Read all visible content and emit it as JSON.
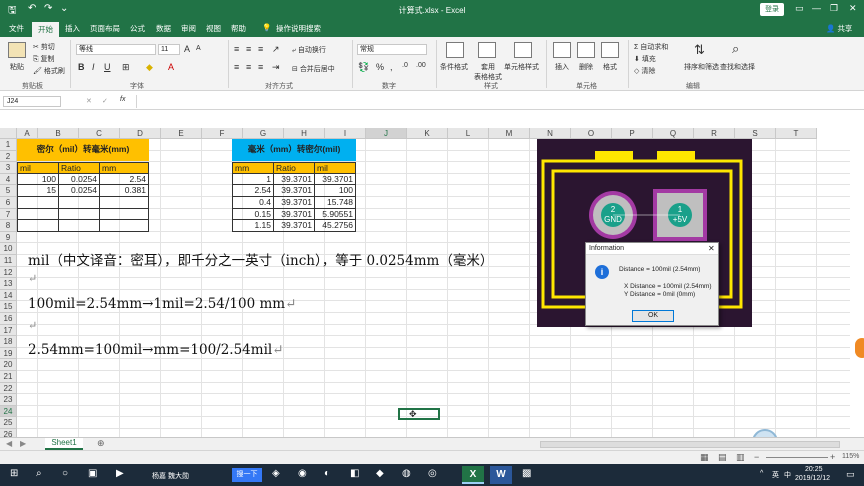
{
  "window": {
    "title": "计算式.xlsx - Excel",
    "login": "登录",
    "share": "共享"
  },
  "tabs": [
    {
      "label": "文件"
    },
    {
      "label": "开始"
    },
    {
      "label": "插入"
    },
    {
      "label": "页面布局"
    },
    {
      "label": "公式"
    },
    {
      "label": "数据"
    },
    {
      "label": "审阅"
    },
    {
      "label": "视图"
    },
    {
      "label": "帮助"
    },
    {
      "label": "操作说明搜索"
    }
  ],
  "ribbon": {
    "paste": "粘贴",
    "cut": "剪切",
    "copy": "复制",
    "format_painter": "格式刷",
    "font_name": "等线",
    "font_size": "11",
    "wrap": "自动换行",
    "merge": "合并后居中",
    "number_format": "常规",
    "cond_format": "条件格式",
    "table_format": "套用\n表格格式",
    "cell_style": "单元格样式",
    "insert": "插入",
    "delete": "删除",
    "format": "格式",
    "autosum": "自动求和",
    "fill": "填充",
    "clear": "清除",
    "sort": "排序和筛选",
    "find": "查找和选择",
    "groups": {
      "clipboard": "剪贴板",
      "font": "字体",
      "align": "对齐方式",
      "number": "数字",
      "styles": "样式",
      "cells": "单元格",
      "edit": "编辑"
    }
  },
  "formula_bar": {
    "name_box": "J24",
    "fx": "fx",
    "value": ""
  },
  "columns": [
    "A",
    "B",
    "C",
    "D",
    "E",
    "F",
    "G",
    "H",
    "I",
    "J",
    "K",
    "L",
    "M",
    "N",
    "O",
    "P",
    "Q",
    "R",
    "S",
    "T"
  ],
  "rows": [
    "1",
    "2",
    "3",
    "4",
    "5",
    "6",
    "7",
    "8",
    "9",
    "10",
    "11",
    "12",
    "13",
    "14",
    "15",
    "16",
    "17",
    "18",
    "19",
    "20",
    "21",
    "22",
    "23",
    "24",
    "25",
    "26"
  ],
  "table1": {
    "title": "密尔（mil）转毫米(mm)",
    "headers": [
      "mil",
      "Ratio",
      "mm"
    ],
    "rows": [
      [
        "100",
        "0.0254",
        "2.54"
      ],
      [
        "15",
        "0.0254",
        "0.381"
      ]
    ]
  },
  "table2": {
    "title": "毫米（mm）转密尔(mil)",
    "headers": [
      "mm",
      "Ratio",
      "mil"
    ],
    "rows": [
      [
        "1",
        "39.3701",
        "39.3701"
      ],
      [
        "2.54",
        "39.3701",
        "100"
      ],
      [
        "0.4",
        "39.3701",
        "15.748"
      ],
      [
        "0.15",
        "39.3701",
        "5.90551"
      ],
      [
        "1.15",
        "39.3701",
        "45.2756"
      ]
    ]
  },
  "notes": {
    "line1": "mil（中文译音：密耳），即千分之一英寸（inch），等于 0.0254mm（毫米）",
    "line2": "100mil=2.54mm→1mil=2.54/100 mm",
    "line3": "2.54mm=100mil→mm=100/2.54mil",
    "return_mark": "↵"
  },
  "pcb": {
    "pad2_num": "2",
    "pad2_net": "GND",
    "pad1_num": "1",
    "pad1_net": "+5V"
  },
  "dialog": {
    "title": "Information",
    "distance": "Distance = 100mil (2.54mm)",
    "x_distance": "X Distance = 100mil (2.54mm)",
    "y_distance": "Y Distance = 0mil (0mm)",
    "ok": "OK"
  },
  "sheet_tab": "Sheet1",
  "status": {
    "zoom": "115%"
  },
  "taskbar": {
    "app": "杨嘉 魏大勋",
    "search_btn": "搜一下",
    "time": "20:25",
    "date": "2019/12/12",
    "lang": "英",
    "ime": "中"
  }
}
